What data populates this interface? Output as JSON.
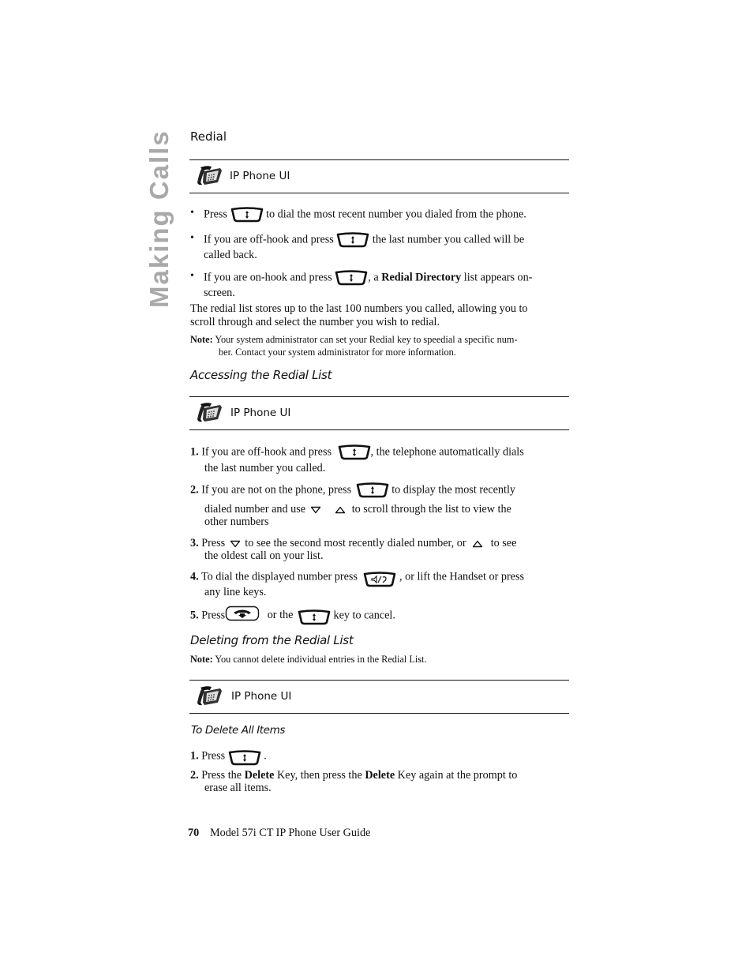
{
  "side_tab": "Making Calls",
  "section": {
    "title": "Redial",
    "ui_bar_label": "IP Phone UI",
    "bullets": [
      {
        "before": "Press",
        "key": "redial-key",
        "after": "to dial the most recent number you dialed from the phone."
      },
      {
        "before": "If you are off-hook and press",
        "key": "redial-key",
        "after": "the last number you called will be",
        "cont": "called back."
      },
      {
        "before": "If you are on-hook and press",
        "key": "redial-key",
        "after_pre": ", a ",
        "bold": "Redial Directory",
        "after": " list appears on-",
        "cont": "screen."
      }
    ],
    "para_line1": "The redial list stores up to the last 100 numbers you called, allowing you to",
    "para_line2": "scroll through and select the number you wish to redial.",
    "note_label": "Note:",
    "note_line1": "Your system administrator can set your Redial key to speedial a specific num-",
    "note_line2": "ber. Contact your system administrator for more information."
  },
  "accessing": {
    "title": "Accessing the Redial List",
    "ui_bar_label": "IP Phone UI",
    "steps": [
      {
        "n": "1.",
        "l1a": "If you are off-hook and press",
        "l1b": ", the telephone automatically dials",
        "l2": "the last number you called."
      },
      {
        "n": "2.",
        "l1a": "If you are not on the phone, press",
        "l1b": "to display the most recently",
        "l2a": "dialed number and use",
        "l2b": "to scroll through the list to view the",
        "l3": "other numbers"
      },
      {
        "n": "3.",
        "l1a": "Press",
        "l1b": "to see the second most recently dialed number, or",
        "l1c": "to see",
        "l2": "the oldest call on your list."
      },
      {
        "n": "4.",
        "l1a": "To dial the displayed number press",
        "l1b": ", or lift the Handset or press",
        "l2": "any line keys."
      },
      {
        "n": "5.",
        "l1a": "Press",
        "l1b": "or the",
        "l1c": "key to cancel."
      }
    ]
  },
  "deleting": {
    "title": "Deleting from the Redial List",
    "note_label": "Note:",
    "note": "You cannot delete individual entries in the Redial List.",
    "ui_bar_label": "IP Phone UI",
    "subtitle": "To Delete All Items",
    "steps": [
      {
        "n": "1.",
        "a": "Press",
        "b": "."
      },
      {
        "n": "2.",
        "a": "Press the ",
        "bold1": "Delete",
        "b": " Key, then press the ",
        "bold2": "Delete",
        "c": " Key again at the prompt to",
        "l2": "erase all items."
      }
    ]
  },
  "footer": {
    "page_number": "70",
    "guide_title": "Model 57i CT IP Phone User Guide"
  }
}
